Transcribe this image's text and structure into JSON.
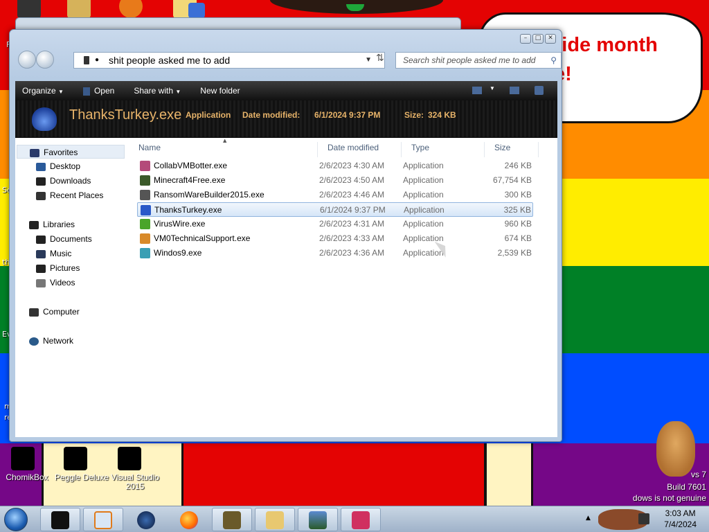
{
  "desktop": {
    "speech_bubble": "ride month\ne!",
    "icons": [
      {
        "label": "ChomikBox"
      },
      {
        "label": "Peggle Deluxe"
      },
      {
        "label": "Visual Studio 2015"
      }
    ],
    "watermark": {
      "line1": "vs 7",
      "line2": "Build 7601",
      "line3": "dows is not genuine"
    },
    "side_fragments": [
      "F",
      "So",
      "th",
      "Ev",
      "m",
      "re"
    ]
  },
  "window": {
    "address": "shit people asked me to add",
    "search_placeholder": "Search shit people asked me to add",
    "toolbar": {
      "organize": "Organize",
      "open": "Open",
      "share_with": "Share with",
      "new_folder": "New folder"
    },
    "details": {
      "name": "ThanksTurkey.exe",
      "type": "Application",
      "date_label": "Date modified:",
      "date_value": "6/1/2024 9:37 PM",
      "size_label": "Size:",
      "size_value": "324 KB"
    },
    "nav": {
      "favorites": "Favorites",
      "desktop": "Desktop",
      "downloads": "Downloads",
      "recent_places": "Recent Places",
      "libraries": "Libraries",
      "documents": "Documents",
      "music": "Music",
      "pictures": "Pictures",
      "videos": "Videos",
      "computer": "Computer",
      "network": "Network"
    },
    "columns": {
      "name": "Name",
      "date": "Date modified",
      "type": "Type",
      "size": "Size"
    },
    "files": [
      {
        "name": "CollabVMBotter.exe",
        "date": "2/6/2023 4:30 AM",
        "type": "Application",
        "size": "246 KB",
        "color": "#b44a7a"
      },
      {
        "name": "Minecraft4Free.exe",
        "date": "2/6/2023 4:50 AM",
        "type": "Application",
        "size": "67,754 KB",
        "color": "#3b5a2a"
      },
      {
        "name": "RansomWareBuilder2015.exe",
        "date": "2/6/2023 4:46 AM",
        "type": "Application",
        "size": "300 KB",
        "color": "#555555"
      },
      {
        "name": "ThanksTurkey.exe",
        "date": "6/1/2024 9:37 PM",
        "type": "Application",
        "size": "325 KB",
        "color": "#2a59c8"
      },
      {
        "name": "VirusWire.exe",
        "date": "2/6/2023 4:31 AM",
        "type": "Application",
        "size": "960 KB",
        "color": "#4aa52a"
      },
      {
        "name": "VM0TechnicalSupport.exe",
        "date": "2/6/2023 4:33 AM",
        "type": "Application",
        "size": "674 KB",
        "color": "#d88a2a"
      },
      {
        "name": "Windos9.exe",
        "date": "2/6/2023 4:36 AM",
        "type": "Application",
        "size": "2,539 KB",
        "color": "#3a9fb4"
      }
    ]
  },
  "taskbar": {
    "time": "3:03 AM",
    "date": "7/4/2024"
  }
}
